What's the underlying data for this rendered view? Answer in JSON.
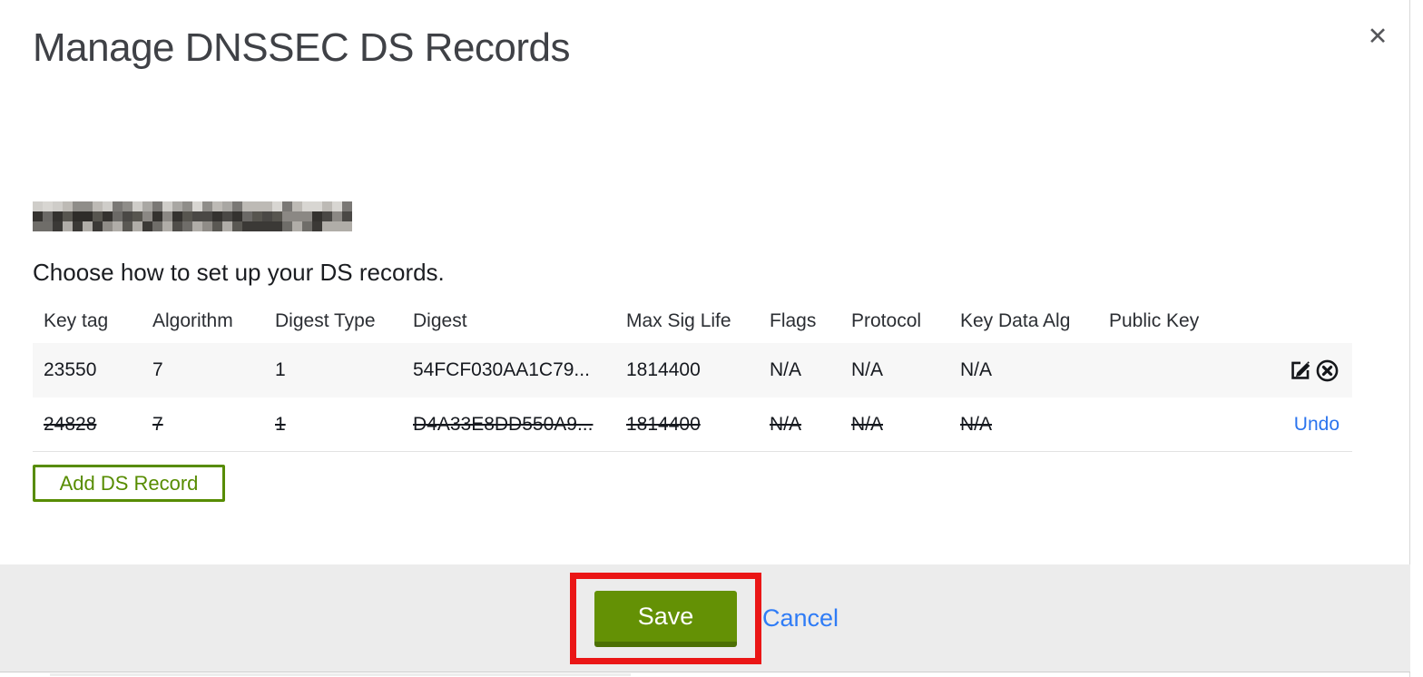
{
  "modal": {
    "title": "Manage DNSSEC DS Records",
    "close_glyph": "✕",
    "instruction": "Choose how to set up your DS records.",
    "table": {
      "columns": [
        "Key tag",
        "Algorithm",
        "Digest Type",
        "Digest",
        "Max Sig Life",
        "Flags",
        "Protocol",
        "Key Data Alg",
        "Public Key"
      ],
      "rows": [
        {
          "key_tag": "23550",
          "algorithm": "7",
          "digest_type": "1",
          "digest": "54FCF030AA1C79...",
          "max_sig_life": "1814400",
          "flags": "N/A",
          "protocol": "N/A",
          "key_data_alg": "N/A",
          "public_key": "",
          "state": "active",
          "actions": [
            "edit",
            "delete"
          ]
        },
        {
          "key_tag": "24828",
          "algorithm": "7",
          "digest_type": "1",
          "digest": "D4A33E8DD550A9...",
          "max_sig_life": "1814400",
          "flags": "N/A",
          "protocol": "N/A",
          "key_data_alg": "N/A",
          "public_key": "",
          "state": "marked-for-deletion",
          "undo_label": "Undo"
        }
      ]
    },
    "add_button_label": "Add DS Record",
    "footer": {
      "save_label": "Save",
      "cancel_label": "Cancel"
    }
  },
  "colors": {
    "accent_green": "#649105",
    "accent_green_dark": "#4c7004",
    "outline_green": "#578c01",
    "link_blue": "#2b74ee",
    "annotation_red": "#ea1616",
    "footer_bg": "#ececec",
    "row_bg": "#f7f7f7"
  }
}
